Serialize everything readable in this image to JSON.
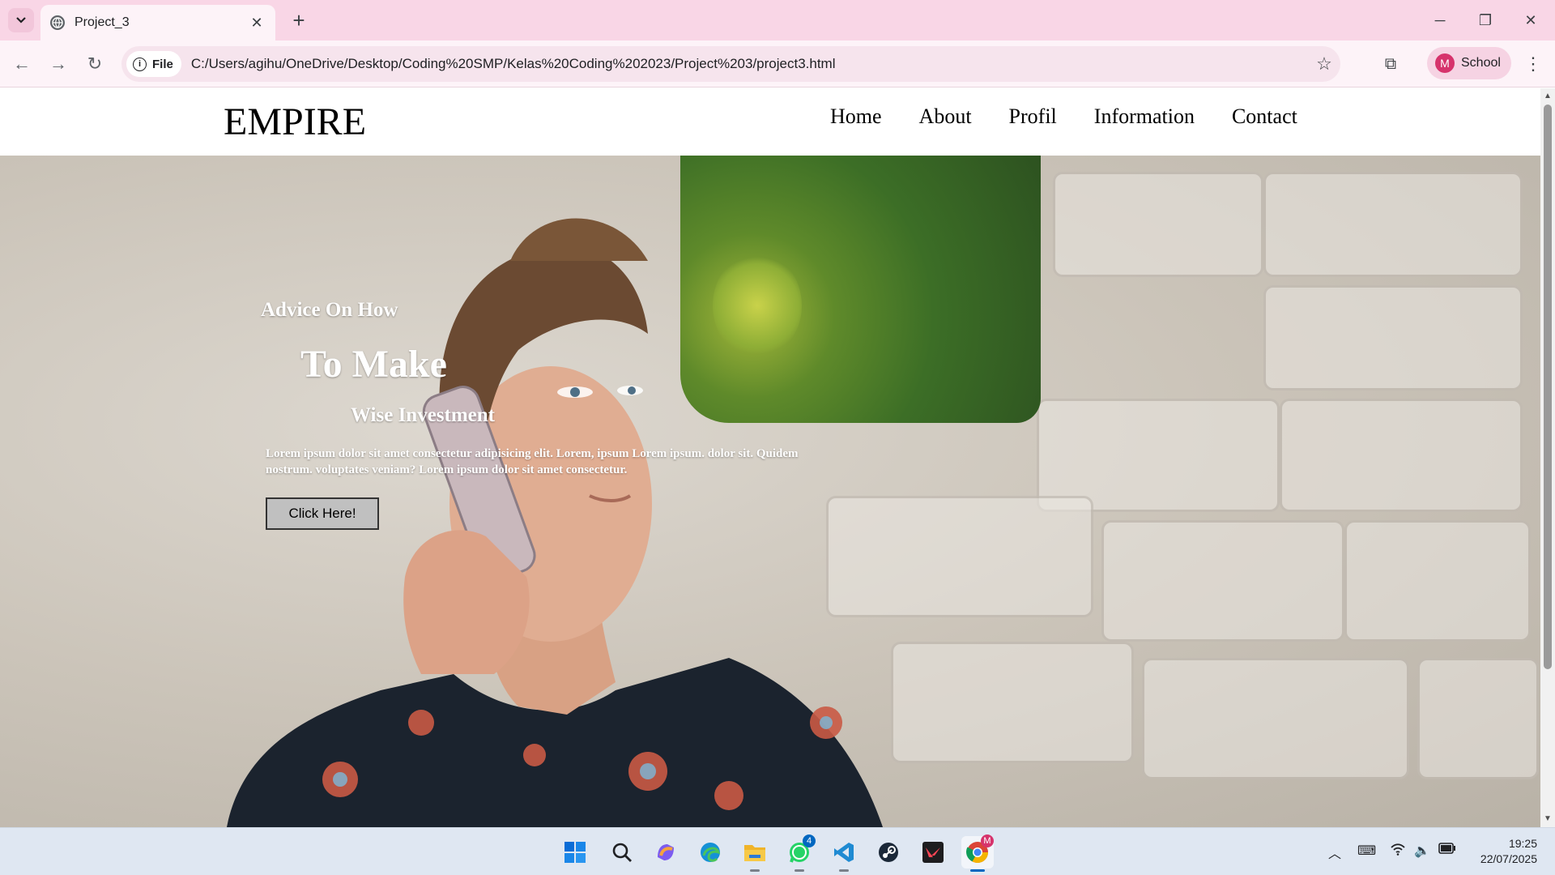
{
  "browser": {
    "tab_title": "Project_3",
    "address_chip": "File",
    "url": "C:/Users/agihu/OneDrive/Desktop/Coding%20SMP/Kelas%20Coding%202023/Project%203/project3.html",
    "profile_initial": "M",
    "profile_name": "School"
  },
  "site": {
    "logo": "EMPIRE",
    "nav": [
      "Home",
      "About",
      "Profil",
      "Information",
      "Contact"
    ],
    "hero": {
      "line1": "Advice On How",
      "line2": "To Make",
      "line3": "Wise Investment",
      "body": "Lorem ipsum dolor sit amet consectetur adipisicing elit. Lorem, ipsum Lorem ipsum. dolor sit. Quidem nostrum. voluptates veniam? Lorem ipsum dolor sit amet consectetur.",
      "button": "Click Here!"
    }
  },
  "taskbar": {
    "icons": [
      "windows-start",
      "search",
      "copilot",
      "edge",
      "file-explorer",
      "whatsapp",
      "vscode",
      "steam",
      "valorant",
      "chrome"
    ],
    "whatsapp_badge": "4",
    "chrome_badge": "M",
    "time": "19:25",
    "date": "22/07/2025"
  },
  "colors": {
    "tabbar": "#f9d6e6",
    "toolbar": "#fdf3f8",
    "taskbar": "#dfe7f2",
    "accent": "#0067c0"
  }
}
